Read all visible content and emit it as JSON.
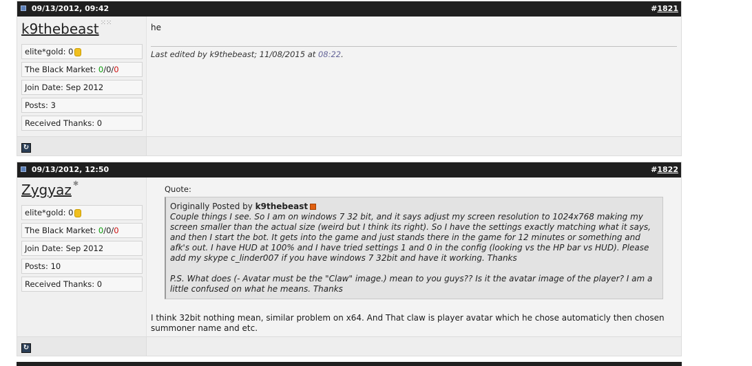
{
  "posts": [
    {
      "date": "09/13/2012, 09:42",
      "post_number_prefix": "#",
      "post_number": "1821",
      "username": "k9thebeast",
      "rank_icon": "spacer-icon",
      "stats": {
        "gold_label": "elite*gold: 0",
        "market_label": "The Black Market: ",
        "market_positive": "0",
        "sep1": "/",
        "market_neutral": "0",
        "sep2": "/",
        "market_negative": "0",
        "join_date": "Join Date: Sep 2012",
        "posts": "Posts: 3",
        "thanks": "Received Thanks: 0"
      },
      "message": "he",
      "edit_prefix": "Last edited by k9thebeast; 11/08/2015 at ",
      "edit_time": "08:22",
      "edit_suffix": "."
    },
    {
      "date": "09/13/2012, 12:50",
      "post_number_prefix": "#",
      "post_number": "1822",
      "username": "Zygyaz",
      "rank_icon": "star-icon",
      "stats": {
        "gold_label": "elite*gold: 0",
        "market_label": "The Black Market: ",
        "market_positive": "0",
        "sep1": "/",
        "market_neutral": "0",
        "sep2": "/",
        "market_negative": "0",
        "join_date": "Join Date: Sep 2012",
        "posts": "Posts: 10",
        "thanks": "Received Thanks: 0"
      },
      "quote_label": "Quote:",
      "quote_by_prefix": "Originally Posted by ",
      "quote_author": "k9thebeast",
      "quote_text_1": "Couple things I see. So I am on windows 7 32 bit, and it says adjust my screen resolution to 1024x768 making my screen smaller than the actual size (weird but I think its right). So I have the settings exactly matching what it says, and then I start the bot. It gets into the game and just stands there in the game for 12 minutes or something and afk's out. I have HUD at 100% and I have tried settings 1 and 0 in the config (looking vs the HP bar vs HUD). Please add my skype c_linder007 if you have windows 7 32bit and have it working. Thanks",
      "quote_text_2": "P.S. What does (- Avatar must be the \"Claw\" image.) mean to you guys?? Is it the avatar image of the player? I am a little confused on what he means. Thanks",
      "message": "I think 32bit nothing mean, similar problem on x64. And That claw is player avatar which he chose automaticly then chosen summoner name and etc."
    }
  ],
  "colors": {
    "header_bg": "#1f1f1f",
    "positive": "#0a9a0a",
    "negative": "#cc1111",
    "edit_time": "#666699"
  }
}
